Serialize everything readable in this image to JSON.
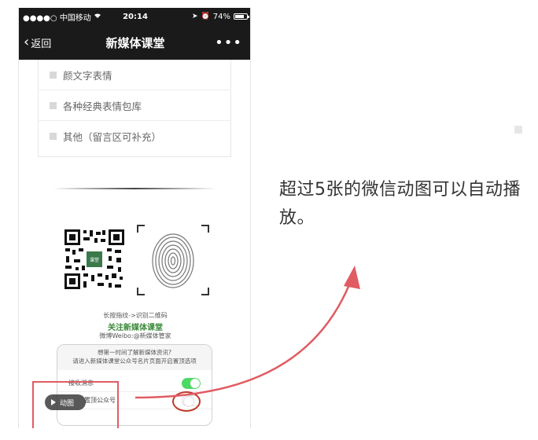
{
  "status_bar": {
    "carrier": "●●●●○ 中国移动",
    "time": "20:14",
    "battery": "74%"
  },
  "nav": {
    "back_label": "返回",
    "title": "新媒体课堂",
    "more_label": "•••"
  },
  "list": {
    "items": [
      {
        "label": "颜文字表情"
      },
      {
        "label": "各种经典表情包库"
      },
      {
        "label": "其他（留言区可补充）"
      }
    ]
  },
  "qr_section": {
    "caption1": "长按指纹->识别二维码",
    "caption2": "关注新媒体课堂",
    "caption3": "微博Weibo:@新媒体管家",
    "qr_center_label": "课堂"
  },
  "mini_card": {
    "header_line1": "想第一时间了解新媒体资讯?",
    "header_line2": "请进入新媒体课堂公众号名片页面开启置顶选项",
    "row1_label": "接收消息",
    "row2_label": "置顶公众号"
  },
  "gif_badge": {
    "label": "动图"
  },
  "annotation": {
    "text": "超过5张的微信动图可以自动播放。"
  },
  "colors": {
    "accent_red": "#e15b62",
    "toggle_green": "#4cd964",
    "nav_bg": "#1a1a1a"
  }
}
